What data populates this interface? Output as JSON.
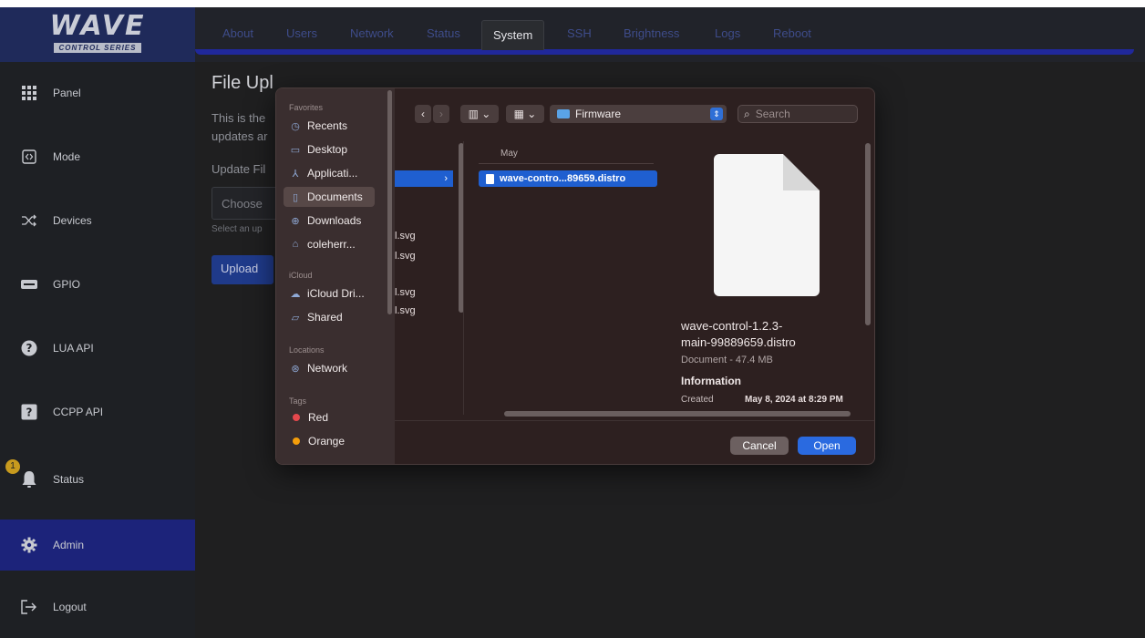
{
  "logo": {
    "title": "WAVE",
    "subtitle": "CONTROL SERIES"
  },
  "sidebar": {
    "items": [
      {
        "label": "Panel",
        "icon": "grid-icon"
      },
      {
        "label": "Mode",
        "icon": "code-icon"
      },
      {
        "label": "Devices",
        "icon": "shuffle-icon"
      },
      {
        "label": "GPIO",
        "icon": "gpio-icon"
      },
      {
        "label": "LUA API",
        "icon": "help-circle-icon"
      },
      {
        "label": "CCPP API",
        "icon": "help-square-icon"
      },
      {
        "label": "Status",
        "icon": "bell-icon",
        "badge": "1"
      },
      {
        "label": "Admin",
        "icon": "gear-icon"
      },
      {
        "label": "Logout",
        "icon": "logout-icon"
      }
    ],
    "active": "Admin"
  },
  "tabs": [
    "About",
    "Users",
    "Network",
    "Status",
    "System",
    "SSH",
    "Brightness",
    "Logs",
    "Reboot"
  ],
  "active_tab": "System",
  "page": {
    "title": "File Upl",
    "para_line1": "This is the",
    "para_line2": "updates ar",
    "field_label": "Update Fil",
    "choose": "Choose",
    "hint": "Select an up",
    "upload": "Upload"
  },
  "dialog": {
    "favorites_header": "Favorites",
    "favorites": [
      "Recents",
      "Desktop",
      "Applicati...",
      "Documents",
      "Downloads",
      "coleherr..."
    ],
    "selected_favorite": "Documents",
    "icloud_header": "iCloud",
    "icloud": [
      "iCloud Dri...",
      "Shared"
    ],
    "locations_header": "Locations",
    "locations": [
      "Network"
    ],
    "tags_header": "Tags",
    "tags": [
      {
        "label": "Red",
        "color": "#e5484d"
      },
      {
        "label": "Orange",
        "color": "#f59e0b"
      }
    ],
    "location": "Firmware",
    "search_placeholder": "Search",
    "col1_files": [
      "l.svg",
      "l.svg",
      "l.svg",
      "l.svg"
    ],
    "col2_header": "May",
    "selected_file": "wave-contro...89659.distro",
    "preview": {
      "name_line1": "wave-control-1.2.3-",
      "name_line2": "main-99889659.distro",
      "meta": "Document - 47.4 MB",
      "info": "Information",
      "created_label": "Created",
      "created_value": "May 8, 2024 at 8:29 PM"
    },
    "cancel": "Cancel",
    "open": "Open"
  }
}
